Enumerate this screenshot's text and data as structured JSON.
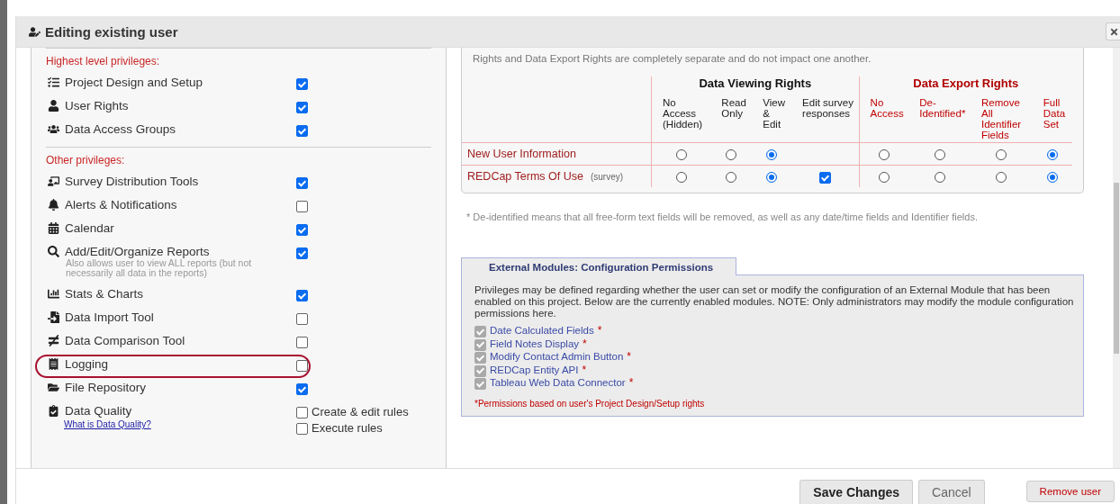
{
  "dialog": {
    "title": "Editing existing user"
  },
  "privileges": [
    {
      "heading": "Highest level privileges:",
      "items": [
        {
          "kind": "check",
          "label": "Project Design and Setup",
          "checked": true,
          "highlighted": false
        },
        {
          "kind": "check",
          "label": "User Rights",
          "checked": true,
          "highlighted": false
        },
        {
          "kind": "check",
          "label": "Data Access Groups",
          "checked": true,
          "highlighted": false
        }
      ]
    },
    {
      "heading": "Other privileges:",
      "items": [
        {
          "kind": "check",
          "label": "Survey Distribution Tools",
          "checked": true,
          "highlighted": false
        },
        {
          "kind": "check",
          "label": "Alerts & Notifications",
          "checked": false,
          "highlighted": false
        },
        {
          "kind": "check",
          "label": "Calendar",
          "checked": true,
          "highlighted": false
        },
        {
          "kind": "check",
          "label": "Add/Edit/Organize Reports",
          "note": "Also allows user to view ALL reports (but not necessarily all data in the reports)",
          "checked": true,
          "highlighted": false
        },
        {
          "kind": "check",
          "label": "Stats & Charts",
          "checked": true,
          "highlighted": false
        },
        {
          "kind": "check",
          "label": "Data Import Tool",
          "checked": false,
          "highlighted": false
        },
        {
          "kind": "check",
          "label": "Data Comparison Tool",
          "checked": false,
          "highlighted": false
        },
        {
          "kind": "check",
          "label": "Logging",
          "checked": false,
          "highlighted": true
        },
        {
          "kind": "check",
          "label": "File Repository",
          "checked": true,
          "highlighted": false
        },
        {
          "kind": "multi",
          "label": "Data Quality",
          "link": "What is Data Quality?",
          "options": [
            {
              "label": "Create & edit rules",
              "checked": false
            },
            {
              "label": "Execute rules",
              "checked": false
            }
          ],
          "highlighted": false
        }
      ]
    }
  ],
  "rights_intro": "Rights and Data Export Rights are completely separate and do not impact one another.",
  "rights_table": {
    "viewing_title": "Data Viewing Rights",
    "viewing_columns": [
      "No Access (Hidden)",
      "Read Only",
      "View & Edit",
      "Edit survey responses"
    ],
    "export_title": "Data Export Rights",
    "export_columns": [
      "No Access",
      "De-Identified*",
      "Remove All Identifier Fields",
      "Full Data Set"
    ],
    "rows": [
      {
        "name": "New User Information",
        "viewing": [
          {
            "selected": false
          },
          {
            "selected": false
          },
          {
            "selected": true
          }
        ],
        "export": [
          {
            "selected": false
          },
          {
            "selected": false
          },
          {
            "selected": false
          },
          {
            "selected": true
          }
        ]
      },
      {
        "name": "REDCap Terms Of Use",
        "note": "(survey)",
        "viewing": [
          {
            "selected": false
          },
          {
            "selected": false
          },
          {
            "selected": true
          }
        ],
        "edit_survey": {
          "checked": true
        },
        "export": [
          {
            "selected": false
          },
          {
            "selected": false
          },
          {
            "selected": false
          },
          {
            "selected": true
          }
        ]
      }
    ]
  },
  "deidentified_note": "* De-identified means that all free-form text fields will be removed, as well as any date/time fields and Identifier fields.",
  "external_modules": {
    "title": "External Modules: Configuration Permissions",
    "description": "Privileges may be defined regarding whether the user can set or modify the configuration of an External Module that has been enabled on this project. Below are the currently enabled modules. NOTE: Only administrators may modify the module configuration permissions here.",
    "modules": [
      {
        "name": "Date Calculated Fields",
        "mark": "*",
        "checked": true,
        "disabled": true
      },
      {
        "name": "Field Notes Display",
        "mark": "*",
        "checked": true,
        "disabled": true
      },
      {
        "name": "Modify Contact Admin Button",
        "mark": "*",
        "checked": true,
        "disabled": true
      },
      {
        "name": "REDCap Entity API",
        "mark": "*",
        "checked": true,
        "disabled": true
      },
      {
        "name": "Tableau Web Data Connector",
        "mark": "*",
        "checked": true,
        "disabled": true
      }
    ],
    "footnote": "*Permissions based on user's Project Design/Setup rights"
  },
  "buttons": [
    {
      "kind": "primary",
      "label": "Save Changes"
    },
    {
      "kind": "secondary",
      "label": "Cancel"
    },
    {
      "kind": "danger",
      "label": "Remove user"
    }
  ]
}
